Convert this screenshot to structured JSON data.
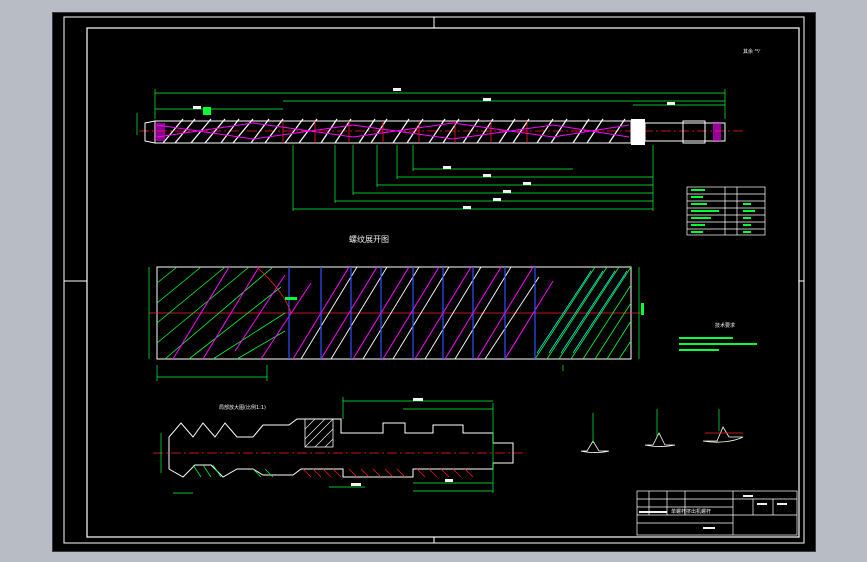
{
  "viewport": {
    "background": "#000000",
    "frame_color": "#ffffff"
  },
  "colors": {
    "green": "#00ff33",
    "white": "#ffffff",
    "magenta": "#ff00ff",
    "red": "#ff2020",
    "blue": "#3050ff",
    "yellow": "#ffff00"
  },
  "sheet": {
    "roughness_mark": "其余 ³²⁄",
    "section_title": "螺纹展开图",
    "detail_title": "局部放大图(比例1:1)",
    "requirements_title": "技术要求"
  },
  "title_block": {
    "drawing_name": "单螺杆挤出机螺杆"
  }
}
